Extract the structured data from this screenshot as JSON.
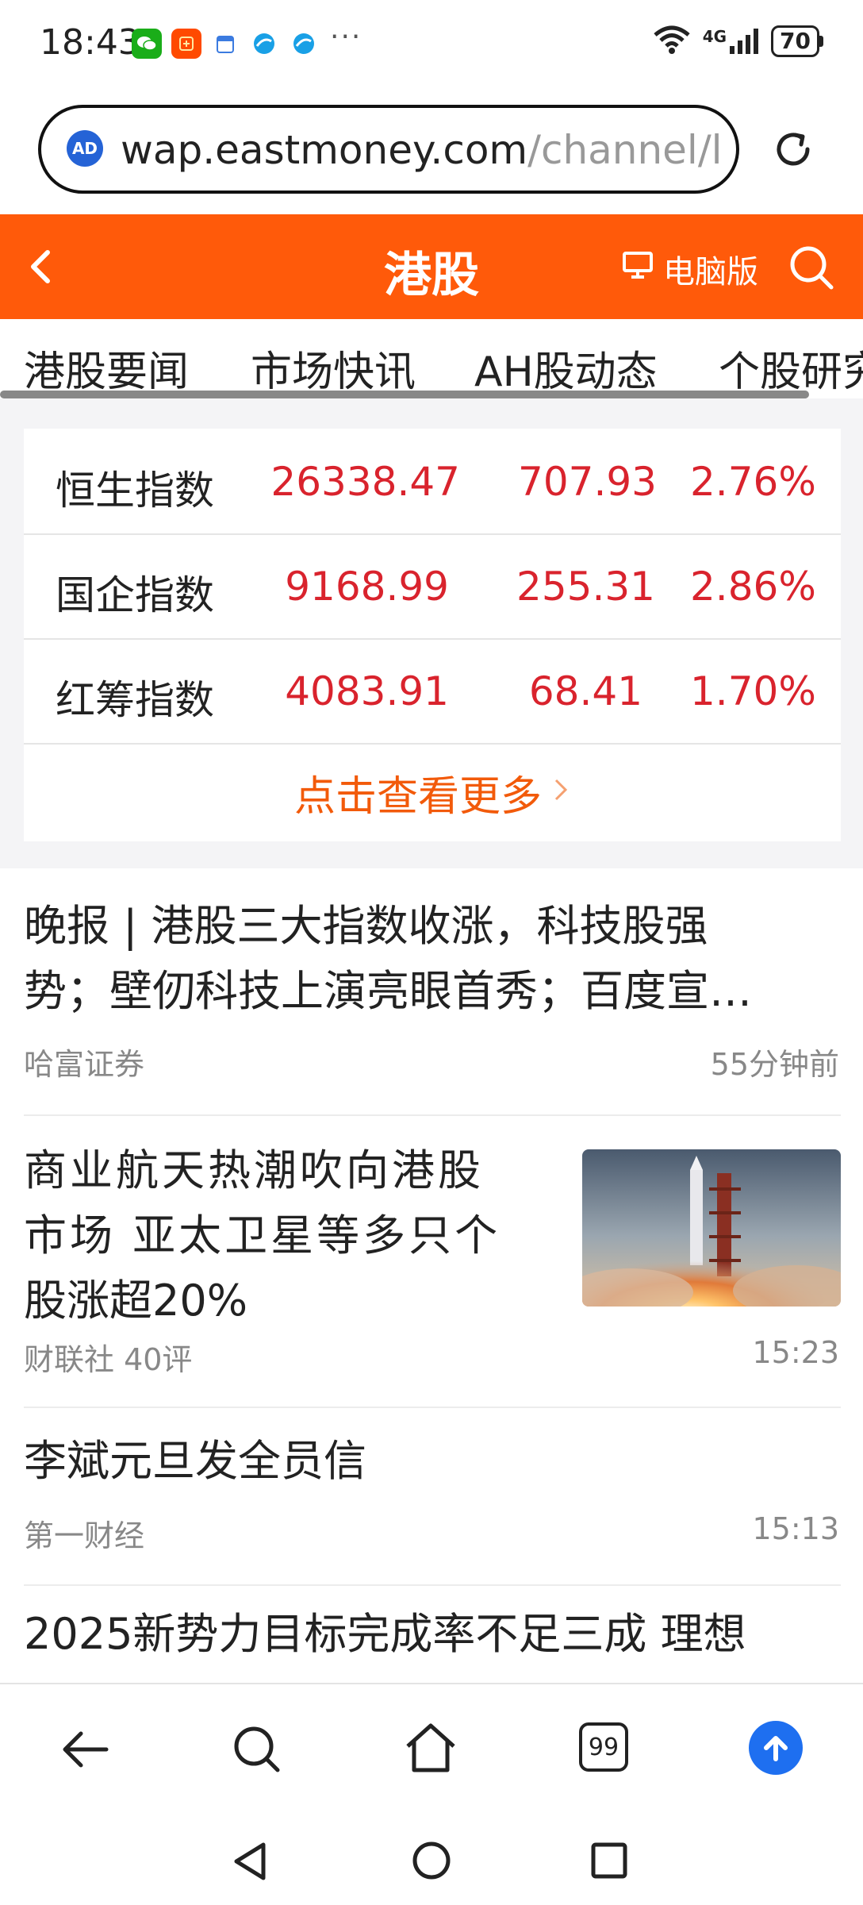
{
  "status_bar": {
    "time": "18:43",
    "dots": "···",
    "network": "4G",
    "battery": "70"
  },
  "url_bar": {
    "badge": "AD",
    "host": "wap.eastmoney.com",
    "path": "/channel/lis"
  },
  "header": {
    "title": "港股",
    "desktop_label": "电脑版"
  },
  "tabs": [
    "港股要闻",
    "市场快讯",
    "AH股动态",
    "个股研究"
  ],
  "indices": [
    {
      "name": "恒生指数",
      "value": "26338.47",
      "change": "707.93",
      "pct": "2.76%"
    },
    {
      "name": "国企指数",
      "value": "9168.99",
      "change": "255.31",
      "pct": "2.86%"
    },
    {
      "name": "红筹指数",
      "value": "4083.91",
      "change": "68.41",
      "pct": "1.70%"
    }
  ],
  "more_label": "点击查看更多",
  "news": [
    {
      "title_line1": "晚报 | 港股三大指数收涨，科技股强",
      "title_line2": "势；壁仞科技上演亮眼首秀；百度宣…",
      "source": "哈富证券",
      "time": "55分钟前"
    },
    {
      "title_line1": "商业航天热潮吹向港股",
      "title_line2": "市场 亚太卫星等多只个",
      "title_line3": "股涨超20%",
      "source": "财联社 40评",
      "time": "15:23"
    },
    {
      "title_line1": "李斌元旦发全员信",
      "source": "第一财经",
      "time": "15:13"
    },
    {
      "title_line1": "2025新势力目标完成率不足三成 理想"
    }
  ],
  "bottom_bar": {
    "tabs_count": "99"
  },
  "colors": {
    "brand_orange": "#ff5a0a",
    "up_red": "#d9232d",
    "more_orange": "#f25a0a",
    "upload_blue": "#1e6ff0"
  }
}
